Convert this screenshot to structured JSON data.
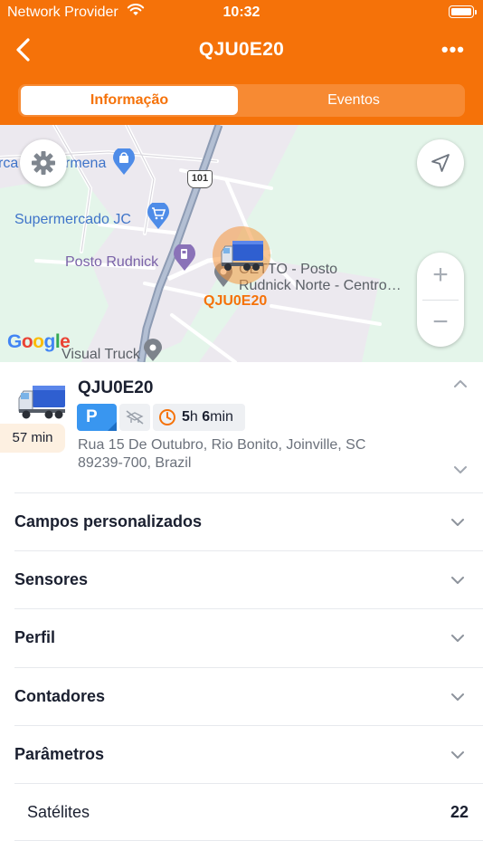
{
  "status_bar": {
    "carrier": "Network Provider",
    "time": "10:32"
  },
  "nav": {
    "title": "QJU0E20",
    "more": "•••",
    "back_icon": "chevron-left-icon"
  },
  "tabs": [
    {
      "label": "Informação",
      "active": true
    },
    {
      "label": "Eventos",
      "active": false
    }
  ],
  "map": {
    "labels": {
      "place_top_left_a": "rca",
      "place_top_left_b": "rmena",
      "supermarket": "Supermercado JC",
      "gas_station": "Posto Rudnick",
      "highway": "101",
      "poi_line1": "CETTO - Posto",
      "poi_line2": "Rudnick Norte - Centro…",
      "vehicle_label": "QJU0E20",
      "truck_poi": "Visual Truck",
      "google": "Google"
    },
    "zoom_in": "+",
    "zoom_out": "−"
  },
  "vehicle": {
    "name": "QJU0E20",
    "stop_duration": "57 min",
    "status_badge": "P",
    "engine_time_hours": "5",
    "engine_time_h_unit": "h",
    "engine_time_minutes": "6",
    "engine_time_min_unit": "min",
    "address": "Rua 15 De Outubro, Rio Bonito, Joinville, SC 89239-700, Brazil"
  },
  "sections": [
    {
      "label": "Campos personalizados"
    },
    {
      "label": "Sensores"
    },
    {
      "label": "Perfil"
    },
    {
      "label": "Contadores"
    },
    {
      "label": "Parâmetros"
    }
  ],
  "parameters": [
    {
      "label": "Satélites",
      "value": "22"
    }
  ],
  "colors": {
    "brand": "#f57209",
    "parking": "#3996f0",
    "map_bg": "#e4f5ea"
  }
}
